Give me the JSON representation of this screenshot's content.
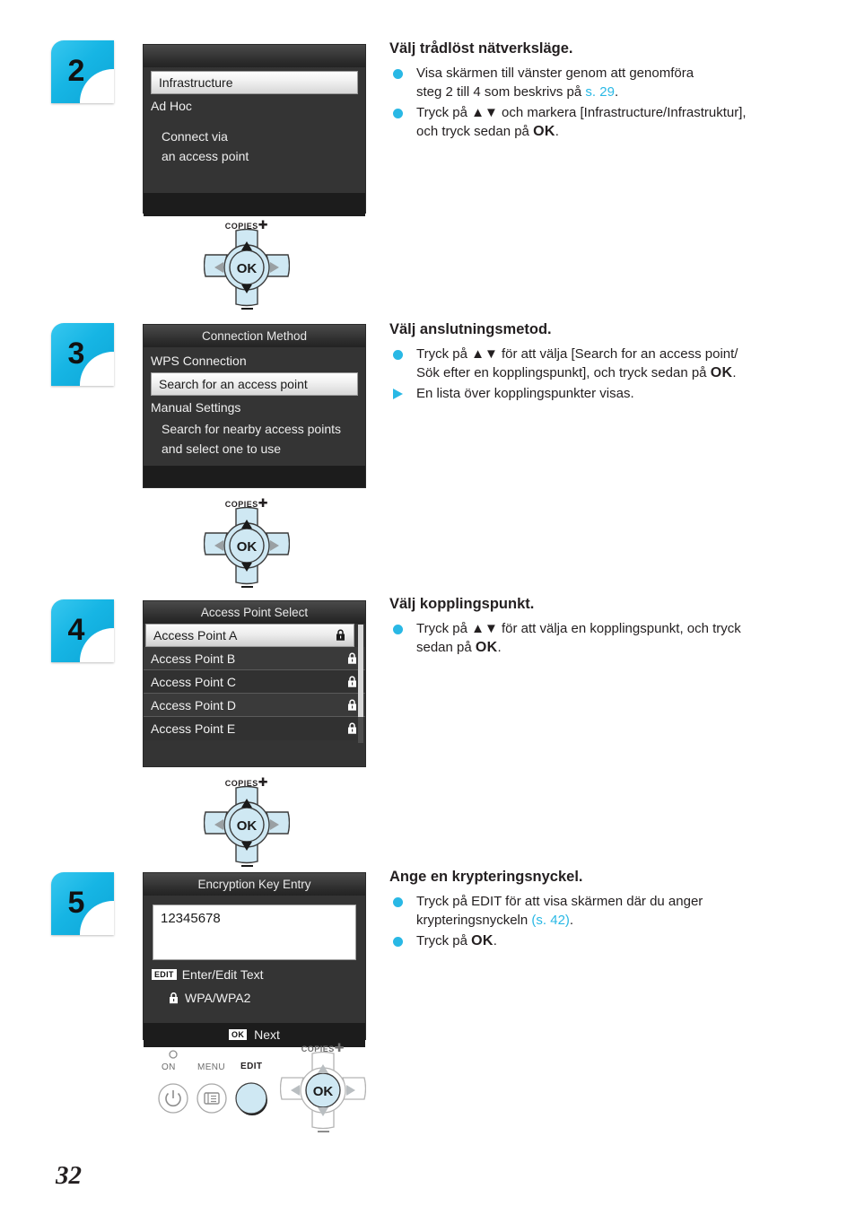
{
  "page": {
    "number": "32"
  },
  "steps": [
    {
      "badge": "2",
      "screen": {
        "title": "",
        "rows": [
          {
            "text": "Infrastructure",
            "selected": true
          },
          {
            "text": "Ad Hoc",
            "selected": false
          }
        ],
        "description": [
          "Connect via",
          "an access point"
        ]
      },
      "heading": "Välj trådlöst nätverksläge.",
      "bullets": [
        {
          "marker": "dot",
          "lines": [
            "Visa skärmen till vänster genom att genomföra",
            "steg 2 till 4 som beskrivs på "
          ],
          "link": "s. 29",
          "tail": "."
        },
        {
          "marker": "dot",
          "lines": [
            "Tryck på ▲▼ och markera [Infrastructure/Infrastruktur],",
            "och tryck sedan på "
          ],
          "strong": "OK",
          "tail": "."
        }
      ]
    },
    {
      "badge": "3",
      "screen": {
        "title": "Connection Method",
        "rows": [
          {
            "text": "WPS Connection",
            "selected": false
          },
          {
            "text": "Search for an access point",
            "selected": true
          },
          {
            "text": "Manual Settings",
            "selected": false
          }
        ],
        "description": [
          "Search for nearby access points",
          "and select one to use"
        ]
      },
      "heading": "Välj anslutningsmetod.",
      "bullets": [
        {
          "marker": "dot",
          "lines": [
            "Tryck på ▲▼ för att välja [Search for an access point/",
            "Sök efter en kopplingspunkt], och tryck sedan på "
          ],
          "strong": "OK",
          "tail": "."
        },
        {
          "marker": "tri",
          "lines": [
            "En lista över kopplingspunkter visas."
          ]
        }
      ]
    },
    {
      "badge": "4",
      "screen": {
        "title": "Access Point Select",
        "access_points": [
          {
            "name": "Access Point A",
            "locked": true,
            "selected": true
          },
          {
            "name": "Access Point B",
            "locked": true,
            "selected": false
          },
          {
            "name": "Access Point C",
            "locked": true,
            "selected": false
          },
          {
            "name": "Access Point D",
            "locked": true,
            "selected": false
          },
          {
            "name": "Access Point E",
            "locked": true,
            "selected": false
          }
        ]
      },
      "heading": "Välj kopplingspunkt.",
      "bullets": [
        {
          "marker": "dot",
          "lines": [
            "Tryck på ▲▼ för att välja en kopplingspunkt, och tryck",
            "sedan på "
          ],
          "strong": "OK",
          "tail": "."
        }
      ]
    },
    {
      "badge": "5",
      "screen": {
        "title": "Encryption Key Entry",
        "key_value": "12345678",
        "edit_tag": "EDIT",
        "edit_label": "Enter/Edit Text",
        "security_label": "WPA/WPA2",
        "footer_tag": "OK",
        "footer_label": "Next"
      },
      "heading": "Ange en krypteringsnyckel.",
      "bullets": [
        {
          "marker": "dot",
          "lines": [
            "Tryck på EDIT för att visa skärmen där du anger",
            "krypteringsnyckeln "
          ],
          "link": "(s. 42)",
          "tail": "."
        },
        {
          "marker": "dot",
          "lines": [
            "Tryck på "
          ],
          "strong": "OK",
          "tail": "."
        }
      ]
    }
  ],
  "dpad": {
    "copies_label": "COPIES",
    "ok_label": "OK"
  },
  "control_panel": {
    "on_label": "ON",
    "menu_label": "MENU",
    "edit_label": "EDIT",
    "copies_label": "COPIES",
    "ok_label": "OK"
  },
  "colors": {
    "accent": "#29b8e5",
    "badge": "#16b5e4",
    "screen_bg": "#343434",
    "text": "#231f20"
  }
}
